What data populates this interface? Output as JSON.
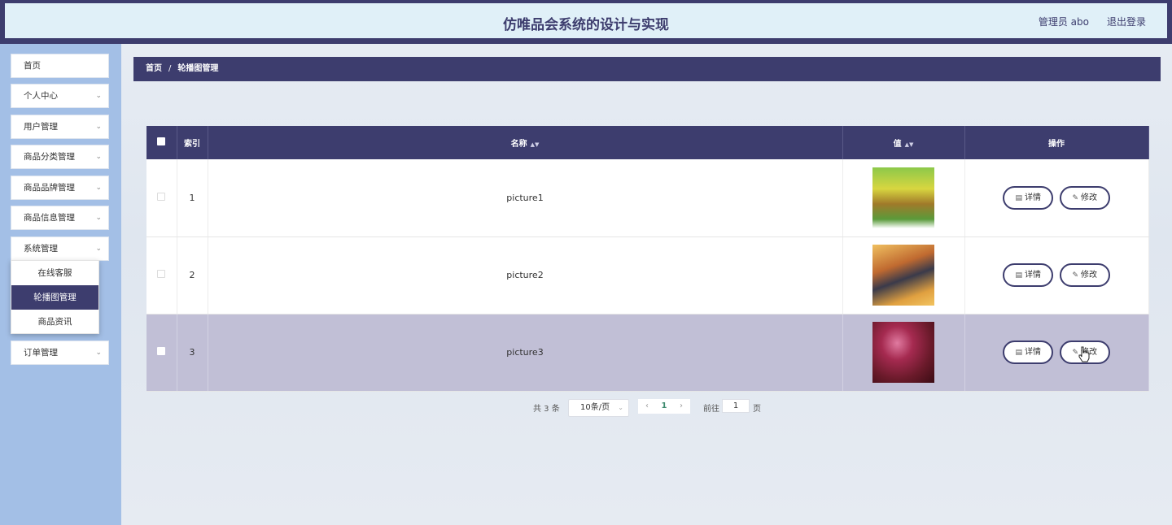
{
  "header": {
    "title": "仿唯品会系统的设计与实现",
    "user": "管理员 abo",
    "logout": "退出登录"
  },
  "sidebar": {
    "items": [
      {
        "label": "首页",
        "has_arrow": false
      },
      {
        "label": "个人中心",
        "has_arrow": true
      },
      {
        "label": "用户管理",
        "has_arrow": true
      },
      {
        "label": "商品分类管理",
        "has_arrow": true
      },
      {
        "label": "商品品牌管理",
        "has_arrow": true
      },
      {
        "label": "商品信息管理",
        "has_arrow": true
      },
      {
        "label": "系统管理",
        "has_arrow": true
      },
      {
        "label": "订单管理",
        "has_arrow": true
      }
    ],
    "submenu": [
      {
        "label": "在线客服",
        "active": false
      },
      {
        "label": "轮播图管理",
        "active": true
      },
      {
        "label": "商品资讯",
        "active": false
      }
    ]
  },
  "breadcrumb": {
    "home": "首页",
    "separator": "/",
    "current": "轮播图管理"
  },
  "table": {
    "headers": {
      "index": "索引",
      "name": "名称",
      "value": "值",
      "actions": "操作"
    },
    "rows": [
      {
        "index": "1",
        "name": "picture1",
        "thumb": "thumb1"
      },
      {
        "index": "2",
        "name": "picture2",
        "thumb": "thumb2"
      },
      {
        "index": "3",
        "name": "picture3",
        "thumb": "thumb3"
      }
    ],
    "detail_label": "详情",
    "edit_label": "修改"
  },
  "pagination": {
    "total": "共 3 条",
    "page_size": "10条/页",
    "current_page": "1",
    "goto_label": "前往",
    "goto_value": "1",
    "page_unit": "页"
  },
  "colors": {
    "primary": "#3d3d6e",
    "sidebar_bg": "#a3bfe6",
    "header_inner": "#e0f0f8",
    "row_hover": "#c1bfd6"
  }
}
